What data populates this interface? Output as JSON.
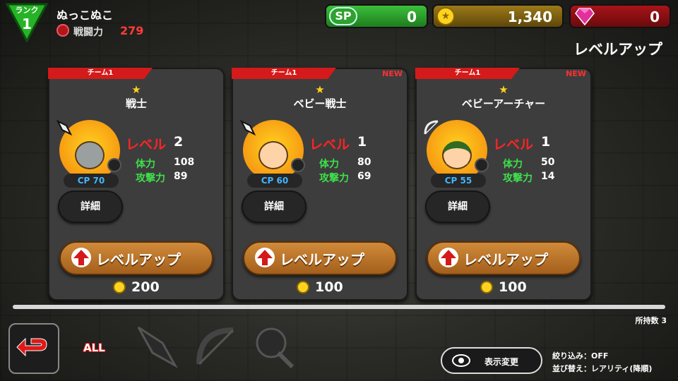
{
  "player": {
    "rank_label": "ランク",
    "rank": "1",
    "name": "ぬっこぬこ",
    "power_label": "戦闘力",
    "power": "279"
  },
  "currency": {
    "sp_label": "SP",
    "sp": "0",
    "coins": "1,340",
    "gems": "0"
  },
  "page_title": "レベルアップ",
  "cards": [
    {
      "team": "チーム1",
      "new": "",
      "star": "★",
      "name": "戦士",
      "level_label": "レベル",
      "level": "2",
      "hp_label": "体力",
      "hp": "108",
      "atk_label": "攻撃力",
      "atk": "89",
      "cp": "CP 70",
      "detail_label": "詳細",
      "levelup_label": "レベルアップ",
      "cost": "200"
    },
    {
      "team": "チーム1",
      "new": "NEW",
      "star": "★",
      "name": "ベビー戦士",
      "level_label": "レベル",
      "level": "1",
      "hp_label": "体力",
      "hp": "80",
      "atk_label": "攻撃力",
      "atk": "69",
      "cp": "CP 60",
      "detail_label": "詳細",
      "levelup_label": "レベルアップ",
      "cost": "100"
    },
    {
      "team": "チーム1",
      "new": "NEW",
      "star": "★",
      "name": "ベビーアーチャー",
      "level_label": "レベル",
      "level": "1",
      "hp_label": "体力",
      "hp": "50",
      "atk_label": "攻撃力",
      "atk": "14",
      "cp": "CP 55",
      "detail_label": "詳細",
      "levelup_label": "レベルアップ",
      "cost": "100"
    }
  ],
  "owned": "所持数 3",
  "filters": {
    "all_label": "ALL",
    "icons": [
      "sword-filter-icon",
      "bow-filter-icon",
      "magic-filter-icon"
    ]
  },
  "view_change_label": "表示変更",
  "sort": {
    "filter_text": "絞り込み：OFF",
    "order_text": "並び替え：レアリティ(降順)"
  },
  "colors": {
    "accent_red": "#d41a1a",
    "level_red": "#ff2424",
    "stat_green": "#3ee04a",
    "cp_blue": "#42b6ff",
    "button_orange": "#c27a30"
  }
}
